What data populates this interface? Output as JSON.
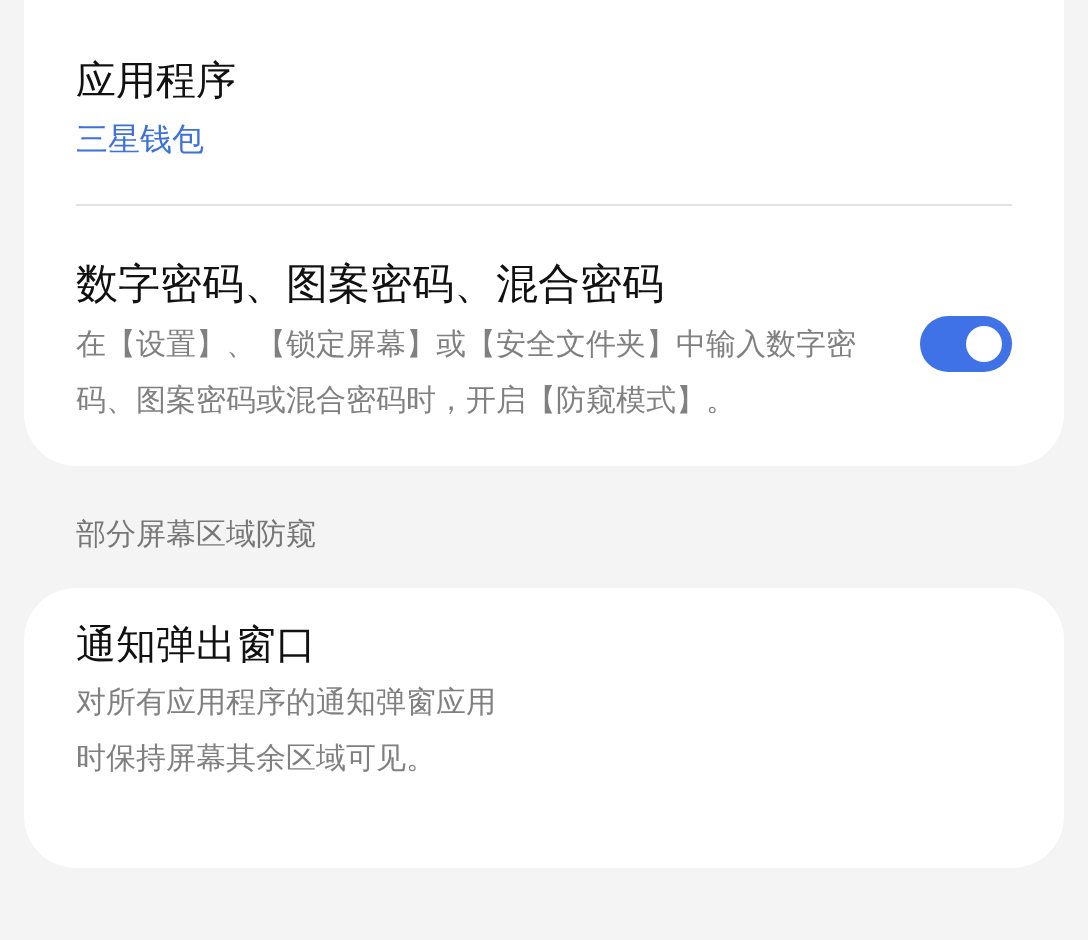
{
  "app_card": {
    "title": "应用程序",
    "value": "三星钱包"
  },
  "password_setting": {
    "title": "数字密码、图案密码、混合密码",
    "description": "在【设置】、【锁定屏幕】或【安全文件夹】中输入数字密码、图案密码或混合密码时，开启【防窥模式】。",
    "on": true
  },
  "section_header": "部分屏幕区域防窥",
  "notification_setting": {
    "title": "通知弹出窗口",
    "description_lines": [
      "对所有应用程序的通知弹窗应用",
      "时保持屏幕其余区域可见。"
    ]
  }
}
